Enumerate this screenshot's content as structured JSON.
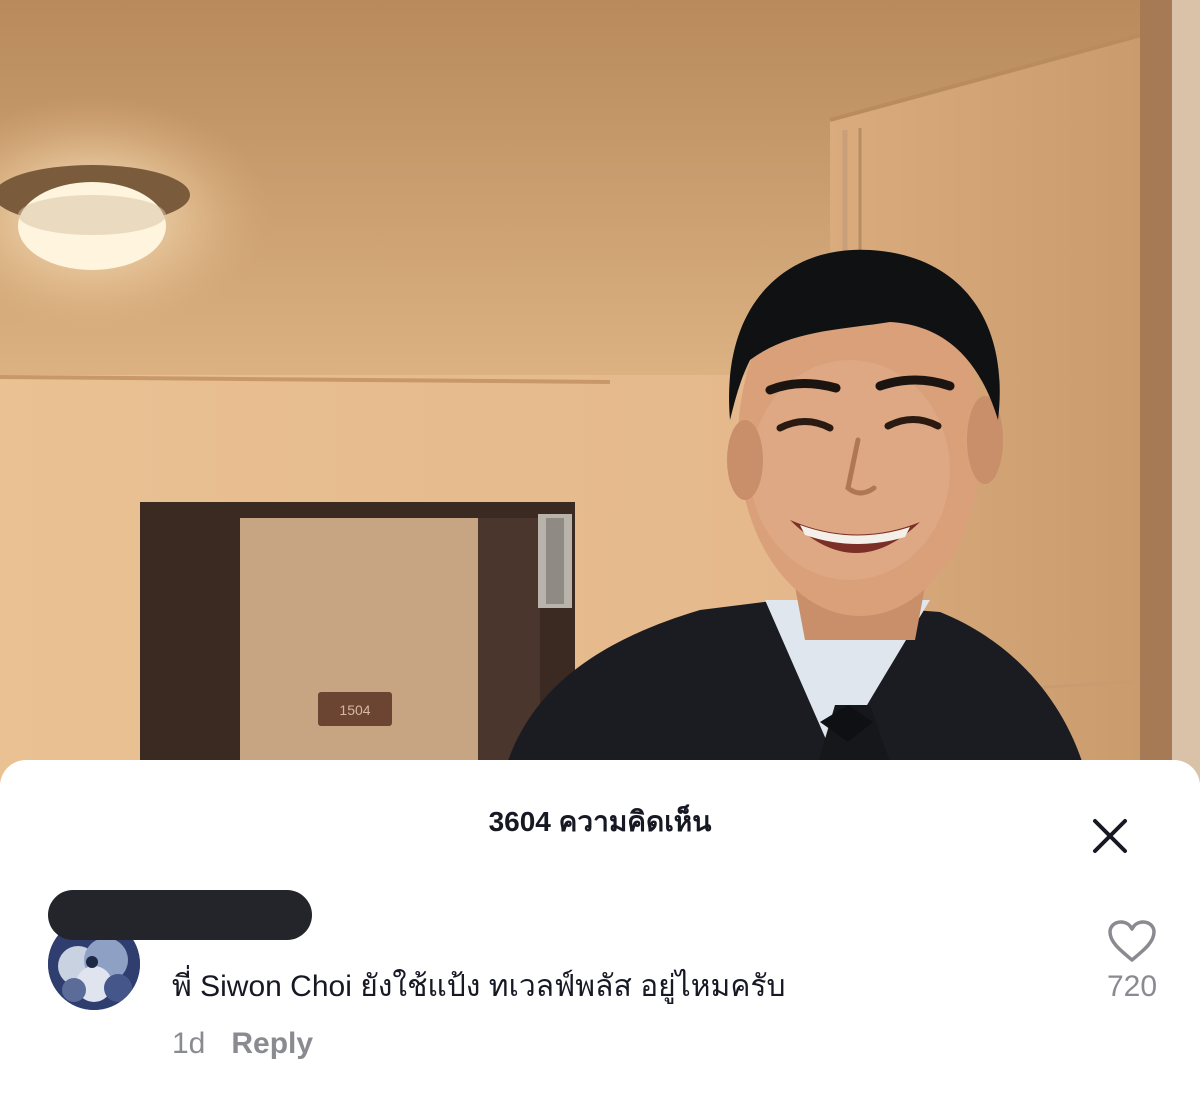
{
  "video": {
    "door_number": "1504"
  },
  "comments_sheet": {
    "title": "3604 ความคิดเห็น",
    "close_icon": "close-icon"
  },
  "comment": {
    "author": "",
    "text": "พี่ Siwon Choi ยังใช้แป้ง ทเวลฟ์พลัส อยู่ไหมครับ",
    "time": "1d",
    "reply_label": "Reply",
    "like_icon": "heart-outline-icon",
    "likes": "720"
  },
  "colors": {
    "text_primary": "#161823",
    "text_secondary": "#8a8b91",
    "sheet_background": "#ffffff",
    "redaction": "#23252b"
  }
}
